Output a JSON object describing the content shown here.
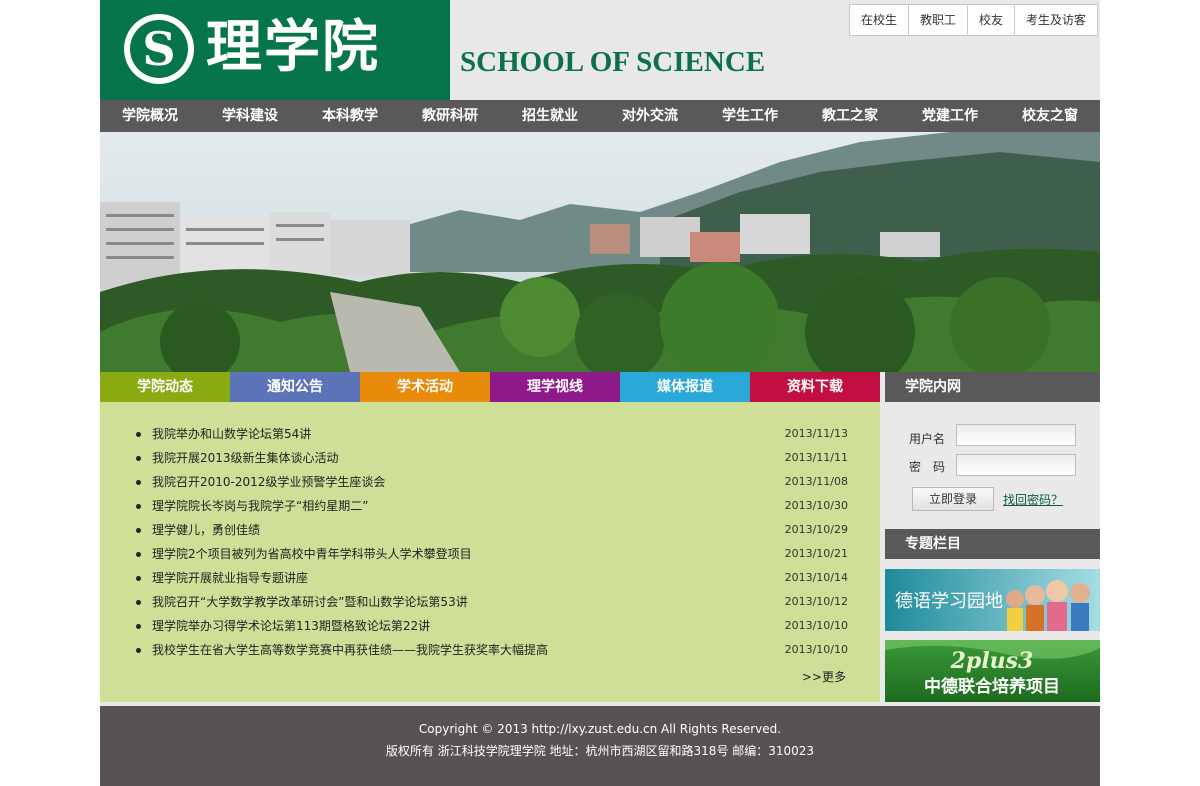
{
  "header": {
    "logo_text": "理学院",
    "logo_mark": "S",
    "school_en": "SCHOOL OF SCIENCE",
    "quick_links": [
      "在校生",
      "教职工",
      "校友",
      "考生及访客"
    ]
  },
  "nav": [
    "学院概况",
    "学科建设",
    "本科教学",
    "教研科研",
    "招生就业",
    "对外交流",
    "学生工作",
    "教工之家",
    "党建工作",
    "校友之窗"
  ],
  "tabs": [
    {
      "label": "学院动态",
      "color": "#8aaa12"
    },
    {
      "label": "通知公告",
      "color": "#5b74b8"
    },
    {
      "label": "学术活动",
      "color": "#e88a0a"
    },
    {
      "label": "理学视线",
      "color": "#8e1a8a"
    },
    {
      "label": "媒体报道",
      "color": "#2aa9d8"
    },
    {
      "label": "资料下载",
      "color": "#c20f42"
    }
  ],
  "news": [
    {
      "title": "我院举办和山数学论坛第54讲",
      "date": "2013/11/13"
    },
    {
      "title": "我院开展2013级新生集体谈心活动",
      "date": "2013/11/11"
    },
    {
      "title": "我院召开2010-2012级学业预警学生座谈会",
      "date": "2013/11/08"
    },
    {
      "title": "理学院院长岑岗与我院学子“相约星期二”",
      "date": "2013/10/30"
    },
    {
      "title": "理学健儿，勇创佳绩",
      "date": "2013/10/29"
    },
    {
      "title": "理学院2个项目被列为省高校中青年学科带头人学术攀登项目",
      "date": "2013/10/21"
    },
    {
      "title": "理学院开展就业指导专题讲座",
      "date": "2013/10/14"
    },
    {
      "title": "我院召开“大学数学教学改革研讨会”暨和山数学论坛第53讲",
      "date": "2013/10/12"
    },
    {
      "title": "理学院举办习得学术论坛第113期暨格致论坛第22讲",
      "date": "2013/10/10"
    },
    {
      "title": "我校学生在省大学生高等数学竞赛中再获佳绩——我院学生获奖率大幅提高",
      "date": "2013/10/10"
    }
  ],
  "more_label": ">>更多",
  "sidebar": {
    "intranet_title": "学院内网",
    "username_label": "用户名",
    "password_label": "密　码",
    "username_value": "",
    "password_value": "",
    "login_button": "立即登录",
    "forgot_link": "找回密码？",
    "topics_title": "专题栏目",
    "promo1_text": "德语学习园地",
    "promo2_title": "2plus3",
    "promo2_text": "中德联合培养项目"
  },
  "footer": {
    "line1": "Copyright © 2013 http://lxy.zust.edu.cn All Rights Reserved.",
    "line2": "版权所有 浙江科技学院理学院   地址：杭州市西湖区留和路318号   邮编：310023"
  }
}
